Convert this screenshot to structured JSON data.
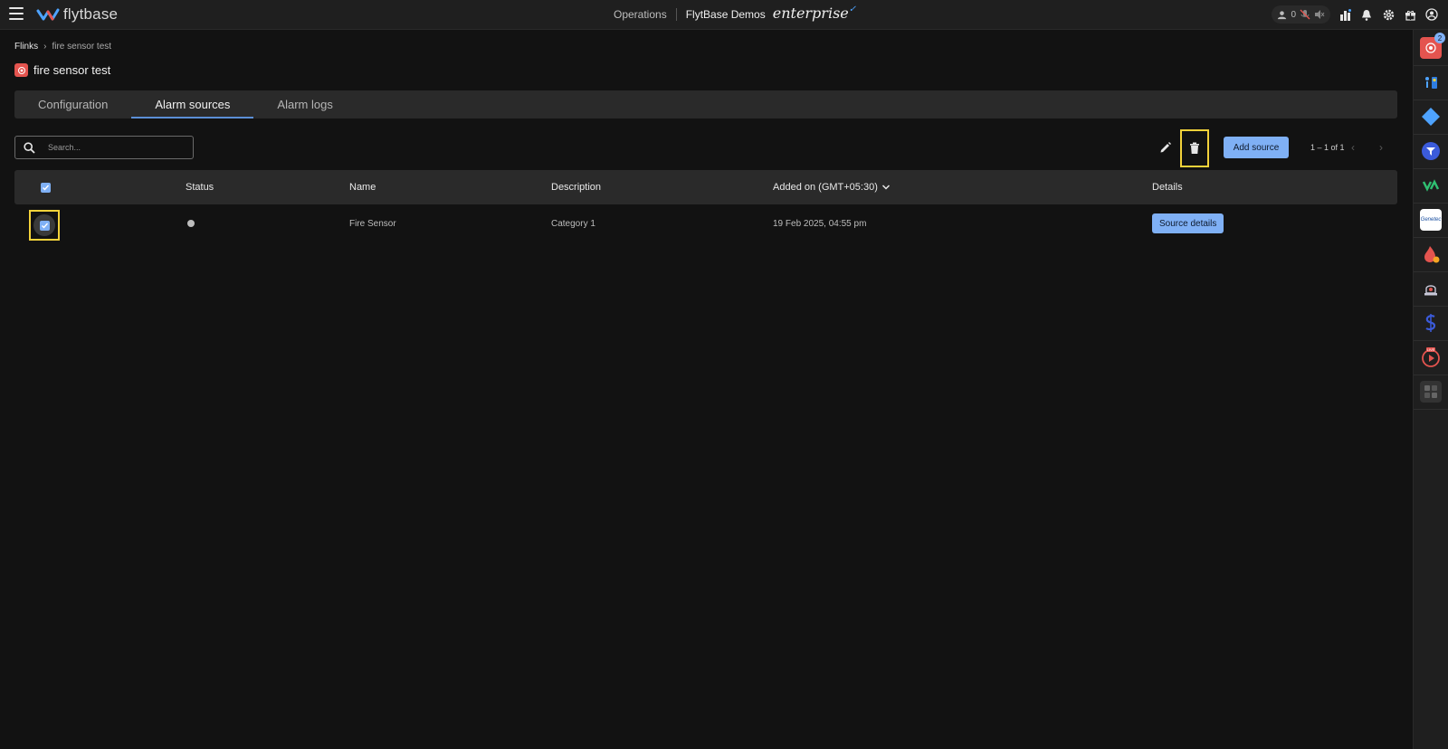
{
  "topbar": {
    "brand": "flytbase",
    "operations": "Operations",
    "org": "FlytBase Demos",
    "edition": "enterprise",
    "user_count": "0"
  },
  "breadcrumb": {
    "root": "Flinks",
    "current": "fire sensor test"
  },
  "page": {
    "title": "fire sensor test"
  },
  "tabs": [
    {
      "label": "Configuration",
      "active": false
    },
    {
      "label": "Alarm sources",
      "active": true
    },
    {
      "label": "Alarm logs",
      "active": false
    }
  ],
  "toolbar": {
    "search_placeholder": "Search...",
    "add_label": "Add source",
    "pagination": "1 – 1 of 1"
  },
  "table": {
    "headers": {
      "status": "Status",
      "name": "Name",
      "description": "Description",
      "added_on": "Added on (GMT+05:30)",
      "details": "Details"
    },
    "rows": [
      {
        "selected": true,
        "status": "inactive",
        "name": "Fire Sensor",
        "description": "Category 1",
        "added_on": "19 Feb 2025, 04:55 pm",
        "action_label": "Source details"
      }
    ]
  },
  "rail": {
    "badge_count": "2",
    "live_label": "LIVE",
    "genetec_label": "Genetec"
  },
  "colors": {
    "accent": "#7fb0f5",
    "highlight": "#f3d23a",
    "background": "#121212",
    "panel": "#2a2a2a"
  }
}
